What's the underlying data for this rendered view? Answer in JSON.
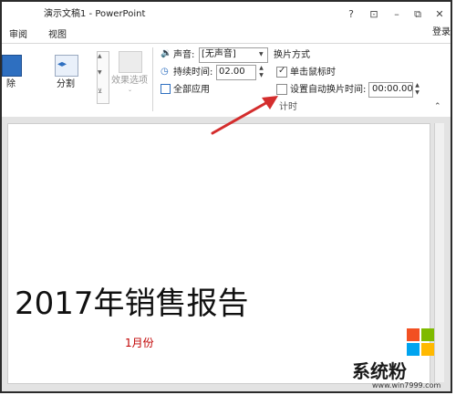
{
  "title_bar": {
    "title": "演示文稿1 - PowerPoint",
    "help": "?",
    "ribbon_options": "⊡",
    "minimize": "–",
    "restore": "⧉",
    "close": "✕",
    "login": "登录"
  },
  "tabs": [
    {
      "label": "审阅"
    },
    {
      "label": "视图"
    }
  ],
  "transitions": {
    "partial_label": "除",
    "split_label": "分割",
    "effect_options_label": "效果选项"
  },
  "timing": {
    "sound_label": "声音:",
    "sound_value": "[无声音]",
    "duration_label": "持续时间:",
    "duration_value": "02.00",
    "apply_all_label": "全部应用",
    "advance_heading": "换片方式",
    "on_click_label": "单击鼠标时",
    "on_click_checked": true,
    "after_label": "设置自动换片时间:",
    "after_checked": false,
    "after_value": "00:00.00",
    "group_label": "计时"
  },
  "slide": {
    "title": "2017年销售报告",
    "subtitle": "1月份"
  },
  "watermark": {
    "brand": "系统粉",
    "url": "www.win7999.com"
  },
  "colors": {
    "arrow": "#d42d2d",
    "subtitle": "#c00000",
    "transition_icon": "#2e6fc0"
  }
}
